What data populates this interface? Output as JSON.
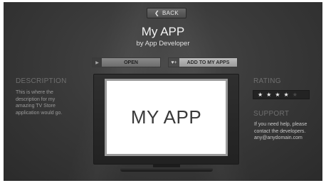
{
  "nav": {
    "back_label": "BACK"
  },
  "app": {
    "title": "My APP",
    "developer": "by App Developer"
  },
  "actions": {
    "open_label": "OPEN",
    "add_label": "ADD TO MY APPS"
  },
  "description": {
    "heading": "DESCRIPTION",
    "lines": [
      "This is where the",
      "description for my",
      "amazing TV Store",
      "application would go."
    ]
  },
  "rating": {
    "heading": "RATING",
    "stars_filled": 4,
    "stars_total": 5
  },
  "support": {
    "heading": "SUPPORT",
    "lines": [
      "If you need help, please",
      "contact the developers.",
      "any@anydomain.com"
    ]
  },
  "preview": {
    "screen_text": "MY APP"
  },
  "icons": {
    "back": "chevron-left-icon",
    "open": "play-icon",
    "add": "heart-add-icon",
    "star": "star-icon"
  }
}
